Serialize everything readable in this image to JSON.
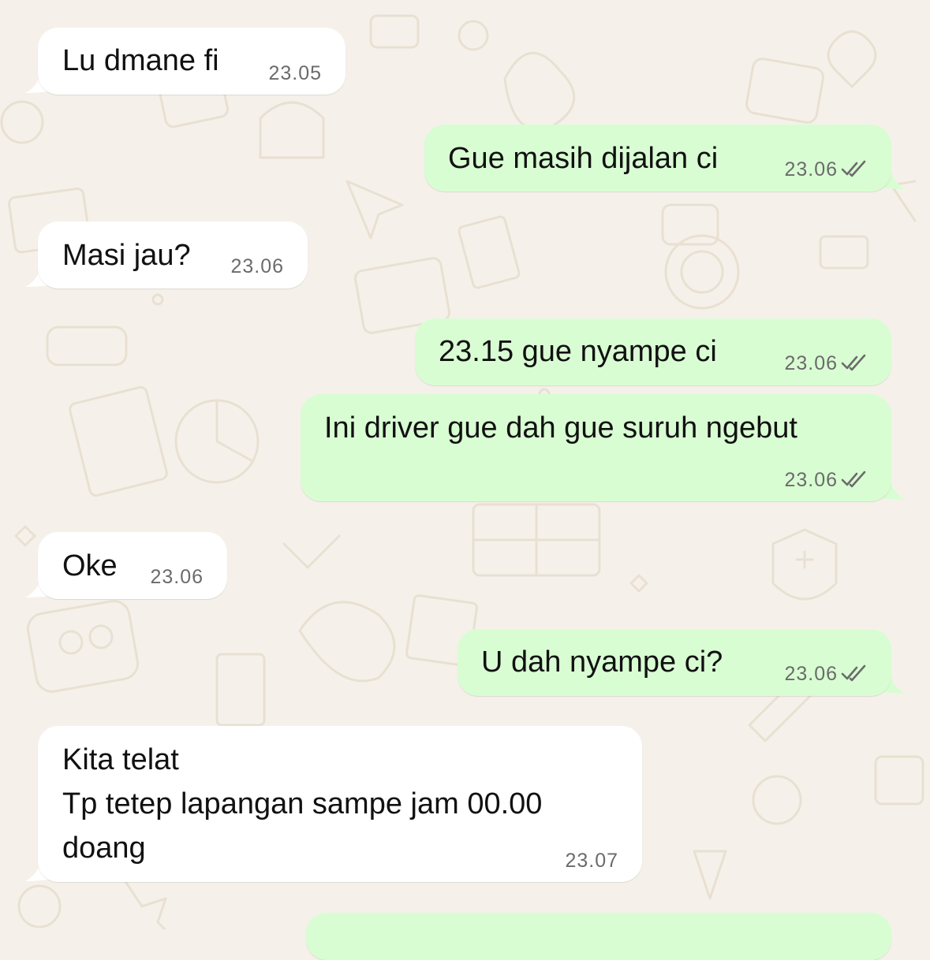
{
  "colors": {
    "background": "#f5f1ea",
    "incoming_bubble": "#ffffff",
    "outgoing_bubble": "#d9fdd3",
    "timestamp": "#6b6b6b",
    "doodle": "#e9e0d2"
  },
  "messages": [
    {
      "direction": "incoming",
      "text": "Lu dmane fi",
      "time": "23.05"
    },
    {
      "direction": "outgoing",
      "text": "Gue masih dijalan ci",
      "time": "23.06",
      "status_icon": "double-check-icon"
    },
    {
      "direction": "incoming",
      "text": "Masi jau?",
      "time": "23.06"
    },
    {
      "direction": "outgoing",
      "text": "23.15 gue nyampe ci",
      "time": "23.06",
      "status_icon": "double-check-icon"
    },
    {
      "direction": "outgoing",
      "text": "Ini driver gue dah gue suruh ngebut",
      "time": "23.06",
      "status_icon": "double-check-icon"
    },
    {
      "direction": "incoming",
      "text": "Oke",
      "time": "23.06"
    },
    {
      "direction": "outgoing",
      "text": "U dah nyampe ci?",
      "time": "23.06",
      "status_icon": "double-check-icon"
    },
    {
      "direction": "incoming",
      "text": "Kita telat\nTp tetep lapangan sampe jam 00.00\ndoang",
      "time": "23.07"
    }
  ]
}
